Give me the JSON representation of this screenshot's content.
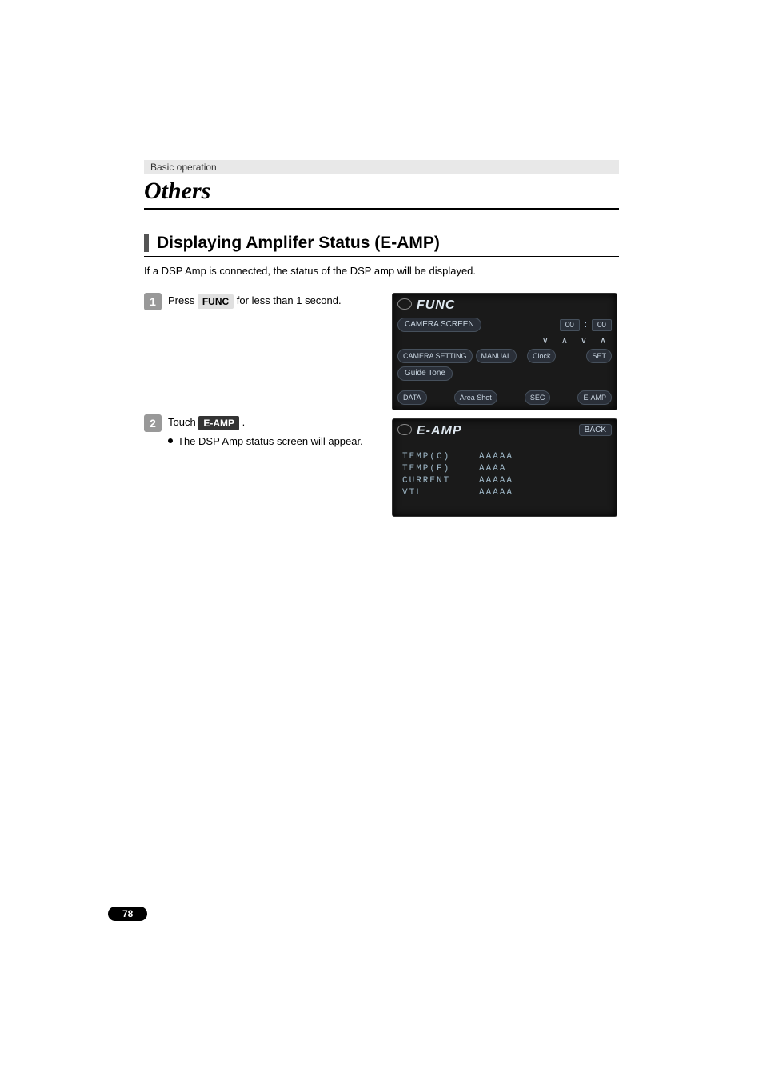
{
  "breadcrumb": "Basic operation",
  "mainTitle": "Others",
  "sectionHeading": "Displaying Amplifer Status (E-AMP)",
  "introText": "If a DSP Amp is connected, the status of the DSP amp will be displayed.",
  "steps": {
    "s1": {
      "num": "1",
      "pre": "Press ",
      "key": "FUNC",
      "post": " for less than 1 second."
    },
    "s2": {
      "num": "2",
      "pre": "Touch ",
      "key": "E-AMP",
      "post": " .",
      "bullet": "The DSP Amp status screen will appear."
    }
  },
  "funcPanel": {
    "title": "FUNC",
    "cameraScreen": "CAMERA SCREEN",
    "cameraSetting": "CAMERA SETTING",
    "manual": "MANUAL",
    "clockLabel": "Clock",
    "clockH": "00",
    "clockSep": ":",
    "clockM": "00",
    "set": "SET",
    "guideTone": "Guide Tone",
    "footer": {
      "data": "DATA",
      "areaShot": "Area Shot",
      "sec": "SEC",
      "eamp": "E-AMP"
    }
  },
  "eampPanel": {
    "title": "E-AMP",
    "back": "BACK",
    "lines": [
      {
        "label": "TEMP(C)",
        "value": "AAAAA"
      },
      {
        "label": "TEMP(F)",
        "value": "AAAA"
      },
      {
        "label": "CURRENT",
        "value": "AAAAA"
      },
      {
        "label": "VTL",
        "value": "AAAAA"
      }
    ]
  },
  "pageNumber": "78"
}
